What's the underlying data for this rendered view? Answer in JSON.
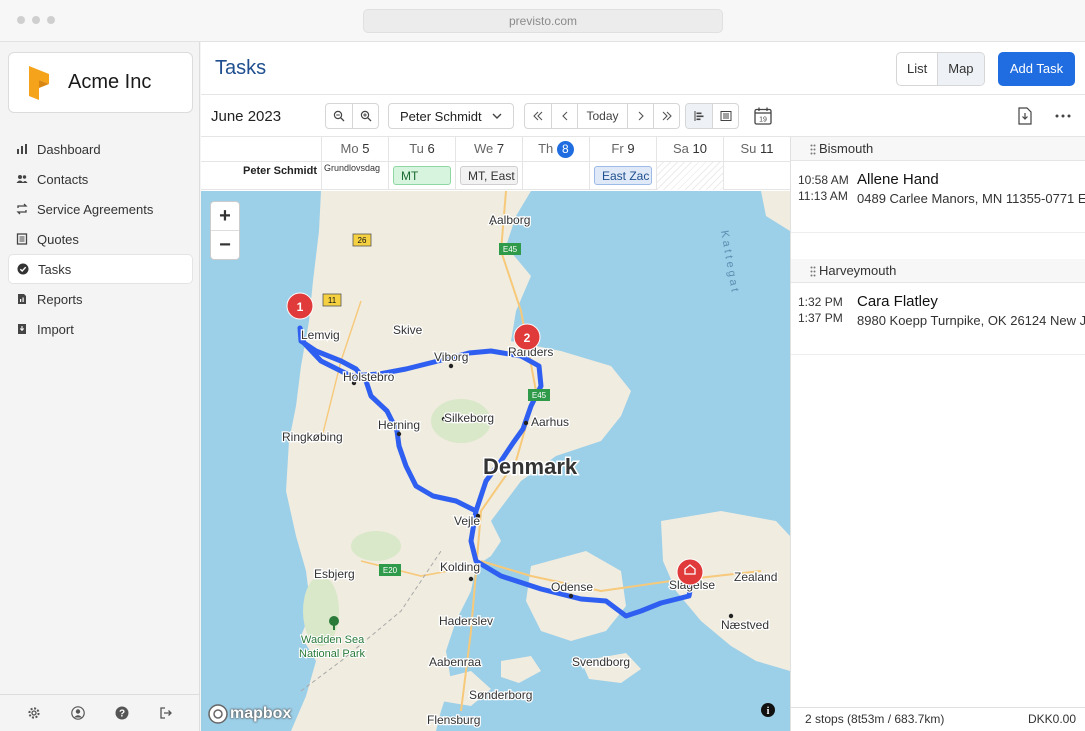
{
  "browser": {
    "url": "previsto.com"
  },
  "brand": {
    "name": "Acme Inc",
    "accent": "#f4a31b"
  },
  "nav": {
    "items": [
      {
        "label": "Dashboard",
        "icon": "bar-chart-icon"
      },
      {
        "label": "Contacts",
        "icon": "people-icon"
      },
      {
        "label": "Service Agreements",
        "icon": "repeat-icon"
      },
      {
        "label": "Quotes",
        "icon": "document-icon"
      },
      {
        "label": "Tasks",
        "icon": "check-circle-icon",
        "active": true
      },
      {
        "label": "Reports",
        "icon": "report-icon"
      },
      {
        "label": "Import",
        "icon": "import-icon"
      }
    ]
  },
  "footer_icons": [
    "settings-icon",
    "user-icon",
    "help-icon",
    "logout-icon"
  ],
  "header": {
    "title": "Tasks",
    "view_list": "List",
    "view_map": "Map",
    "add_task": "Add Task",
    "primary_color": "#1f6de0"
  },
  "toolbar": {
    "month": "June 2023",
    "person": "Peter Schmidt",
    "today": "Today",
    "calendar_day": "19"
  },
  "schedule": {
    "days": [
      {
        "name": "Mo",
        "num": "5"
      },
      {
        "name": "Tu",
        "num": "6"
      },
      {
        "name": "We",
        "num": "7"
      },
      {
        "name": "Th",
        "num": "8",
        "today": true
      },
      {
        "name": "Fr",
        "num": "9"
      },
      {
        "name": "Sa",
        "num": "10"
      },
      {
        "name": "Su",
        "num": "11"
      }
    ],
    "row_label": "Peter Schmidt",
    "events": {
      "mo": "Grundlovsdag",
      "tu": "MT",
      "we": "MT, East",
      "fr": "East Zac"
    }
  },
  "map": {
    "country": "Denmark",
    "attribution": "mapbox",
    "labels": {
      "aalborg": "Aalborg",
      "lemvig": "Lemvig",
      "skive": "Skive",
      "randers": "Randers",
      "viborg": "Viborg",
      "holstebro": "Holstebro",
      "silkeborg": "Silkeborg",
      "aarhus": "Aarhus",
      "ringkobing": "Ringkøbing",
      "herning": "Herning",
      "vejle": "Vejle",
      "kolding": "Kolding",
      "odense": "Odense",
      "slagelse": "Slagelse",
      "zealand": "Zealand",
      "esbjerg": "Esbjerg",
      "haderslev": "Haderslev",
      "naestved": "Næstved",
      "wadden": "Wadden Sea",
      "national_park": "National Park",
      "aabenraa": "Aabenraa",
      "svendborg": "Svendborg",
      "sonderborg": "Sønderborg",
      "flensburg": "Flensburg",
      "kattegat": "Kattegat"
    },
    "road_shields": [
      "26",
      "11",
      "E45",
      "E45",
      "E20"
    ],
    "markers": [
      "1",
      "2"
    ],
    "route_color": "#2f5ff0",
    "marker_color": "#e03a3a"
  },
  "stops": {
    "groups": [
      {
        "name": "Bismouth",
        "items": [
          {
            "start": "10:58 AM",
            "end": "11:13 AM",
            "name": "Allene Hand",
            "address": "0489 Carlee Manors, MN 11355-0771 Ea"
          }
        ]
      },
      {
        "name": "Harveymouth",
        "items": [
          {
            "start": "1:32 PM",
            "end": "1:37 PM",
            "name": "Cara Flatley",
            "address": "8980 Koepp Turnpike, OK 26124 New Jac"
          }
        ]
      }
    ],
    "summary": "2 stops (8t53m / 683.7km)",
    "total": "DKK0.00"
  }
}
